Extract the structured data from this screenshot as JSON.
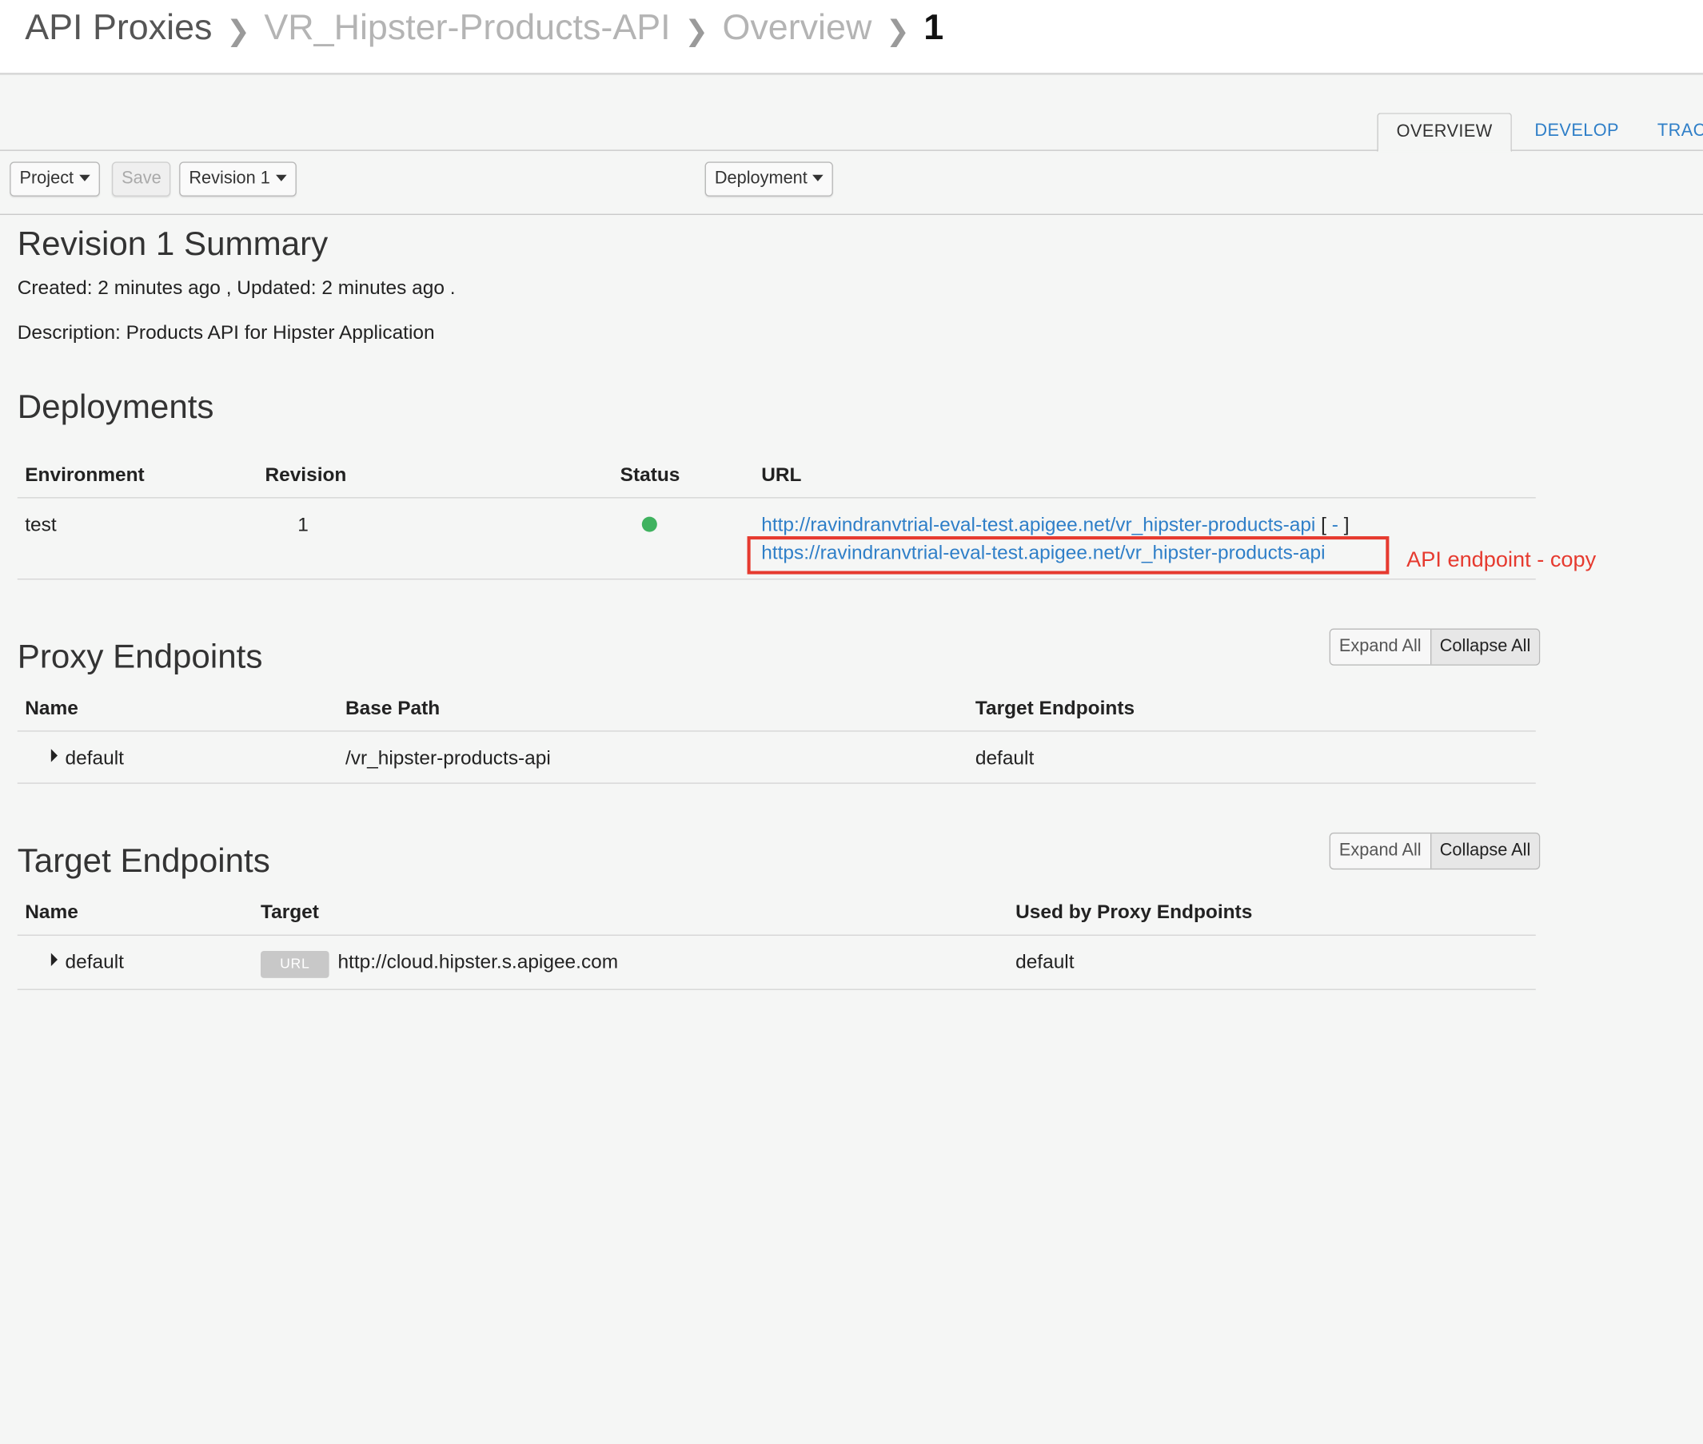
{
  "breadcrumb": [
    "API Proxies",
    "VR_Hipster-Products-API",
    "Overview",
    "1"
  ],
  "tabs": [
    "OVERVIEW",
    "DEVELOP",
    "TRAC"
  ],
  "toolbar": {
    "project": "Project",
    "save": "Save",
    "revision": "Revision 1",
    "deployment": "Deployment"
  },
  "summary": {
    "title": "Revision 1 Summary",
    "created": "Created: 2 minutes ago , Updated: 2 minutes ago .",
    "description": "Description: Products API for Hipster Application"
  },
  "deployments": {
    "title": "Deployments",
    "headers": [
      "Environment",
      "Revision",
      "Status",
      "URL"
    ],
    "row": {
      "environment": "test",
      "revision": "1",
      "status_color": "#3fb25f",
      "url_http": "http://ravindranvtrial-eval-test.apigee.net/vr_hipster-products-api",
      "bracket_open": "[",
      "collapse": "-",
      "bracket_close": "]",
      "url_https": "https://ravindranvtrial-eval-test.apigee.net/vr_hipster-products-api"
    },
    "annotation": "API endpoint - copy"
  },
  "proxy_endpoints": {
    "title": "Proxy Endpoints",
    "expand_all": "Expand All",
    "collapse_all": "Collapse All",
    "headers": [
      "Name",
      "Base Path",
      "Target Endpoints"
    ],
    "row": {
      "name": "default",
      "base_path": "/vr_hipster-products-api",
      "target": "default"
    }
  },
  "target_endpoints": {
    "title": "Target Endpoints",
    "expand_all": "Expand All",
    "collapse_all": "Collapse All",
    "headers": [
      "Name",
      "Target",
      "Used by Proxy Endpoints"
    ],
    "row": {
      "name": "default",
      "badge": "URL",
      "target": "http://cloud.hipster.s.apigee.com",
      "used_by": "default"
    }
  }
}
